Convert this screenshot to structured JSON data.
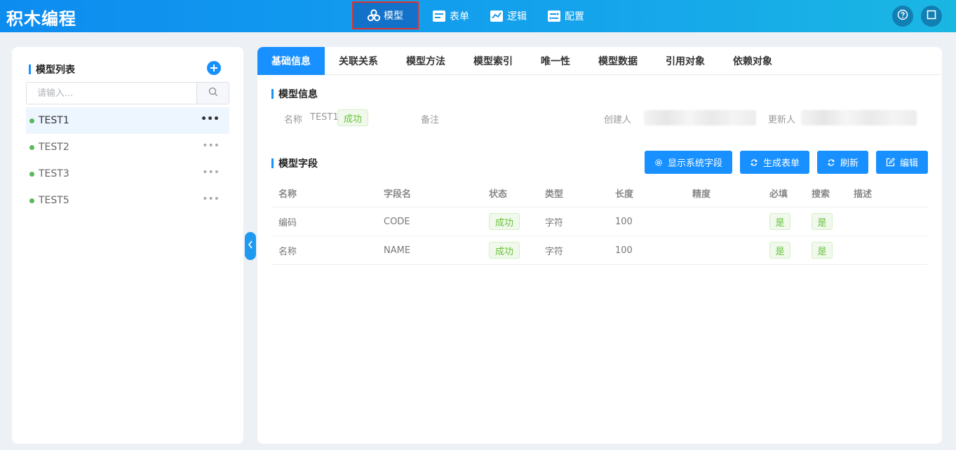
{
  "header": {
    "app_title": "积木编程",
    "nav": [
      {
        "label": "模型",
        "icon": "cubes-icon",
        "active": true
      },
      {
        "label": "表单",
        "icon": "form-icon",
        "active": false
      },
      {
        "label": "逻辑",
        "icon": "puzzle-icon",
        "active": false
      },
      {
        "label": "配置",
        "icon": "config-icon",
        "active": false
      }
    ],
    "help_icon": "help-circle-icon",
    "fullscreen_icon": "square-icon"
  },
  "sidebar": {
    "title": "模型列表",
    "add_icon": "plus-circle-icon",
    "search_placeholder": "请输入...",
    "search_icon": "search-icon",
    "items": [
      {
        "name": "TEST1",
        "selected": true
      },
      {
        "name": "TEST2",
        "selected": false
      },
      {
        "name": "TEST3",
        "selected": false
      },
      {
        "name": "TEST5",
        "selected": false
      }
    ],
    "more_label": "•••",
    "status_color": "#5cb85c"
  },
  "collapse_icon": "chevron-left-icon",
  "tabs": [
    "基础信息",
    "关联关系",
    "模型方法",
    "模型索引",
    "唯一性",
    "模型数据",
    "引用对象",
    "依赖对象"
  ],
  "model_info": {
    "section_title": "模型信息",
    "name_label": "名称",
    "name_value": "TEST1",
    "status": "成功",
    "remark_label": "备注",
    "creator_label": "创建人",
    "updater_label": "更新人"
  },
  "model_fields": {
    "section_title": "模型字段",
    "buttons": [
      {
        "label": "显示系统字段",
        "icon": "settings-icon"
      },
      {
        "label": "生成表单",
        "icon": "refresh-icon"
      },
      {
        "label": "刷新",
        "icon": "refresh-icon"
      },
      {
        "label": "编辑",
        "icon": "edit-icon"
      }
    ],
    "columns": [
      "名称",
      "字段名",
      "状态",
      "类型",
      "长度",
      "精度",
      "必填",
      "搜索",
      "描述"
    ],
    "rows": [
      {
        "name": "编码",
        "field": "CODE",
        "status": "成功",
        "type": "字符",
        "length": "100",
        "precision": "",
        "required": "是",
        "searchable": "是",
        "desc": ""
      },
      {
        "name": "名称",
        "field": "NAME",
        "status": "成功",
        "type": "字符",
        "length": "100",
        "precision": "",
        "required": "是",
        "searchable": "是",
        "desc": ""
      }
    ]
  },
  "colors": {
    "primary": "#1890ff",
    "success_text": "#67c23a",
    "success_bg": "#f0f9eb",
    "active_nav_border": "#e0312c"
  }
}
